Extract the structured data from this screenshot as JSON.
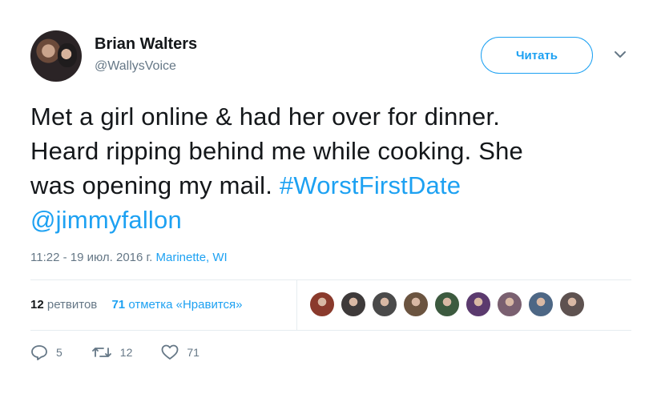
{
  "author": {
    "name": "Brian Walters",
    "handle": "@WallysVoice"
  },
  "follow_label": "Читать",
  "tweet": {
    "line1": "Met a girl online & had her over for dinner.",
    "line2": "Heard ripping behind me while cooking. She",
    "line3_text": "was opening my mail. ",
    "hashtag": "#WorstFirstDate",
    "mention": "@jimmyfallon"
  },
  "meta": {
    "time": "11:22 - 19 июл. 2016 г.",
    "location": "Marinette, WI"
  },
  "stats": {
    "retweets_count": "12",
    "retweets_label": "ретвитов",
    "likes_count": "71",
    "likes_label": "отметка «Нравится»"
  },
  "likers": [
    {
      "name": "avatar-1",
      "color": "#8a3a2c"
    },
    {
      "name": "avatar-2",
      "color": "#3e3a3a"
    },
    {
      "name": "avatar-3",
      "color": "#4a4a4a"
    },
    {
      "name": "avatar-4",
      "color": "#6b5440"
    },
    {
      "name": "avatar-5",
      "color": "#3c5a3f"
    },
    {
      "name": "avatar-6",
      "color": "#5b3a6e"
    },
    {
      "name": "avatar-7",
      "color": "#7a6070"
    },
    {
      "name": "avatar-8",
      "color": "#4d6785"
    },
    {
      "name": "avatar-9",
      "color": "#5e5250"
    }
  ],
  "actions": {
    "reply_count": "5",
    "retweet_count": "12",
    "like_count": "71"
  },
  "colors": {
    "accent": "#1da1f2",
    "muted": "#657786",
    "text": "#14171a"
  }
}
